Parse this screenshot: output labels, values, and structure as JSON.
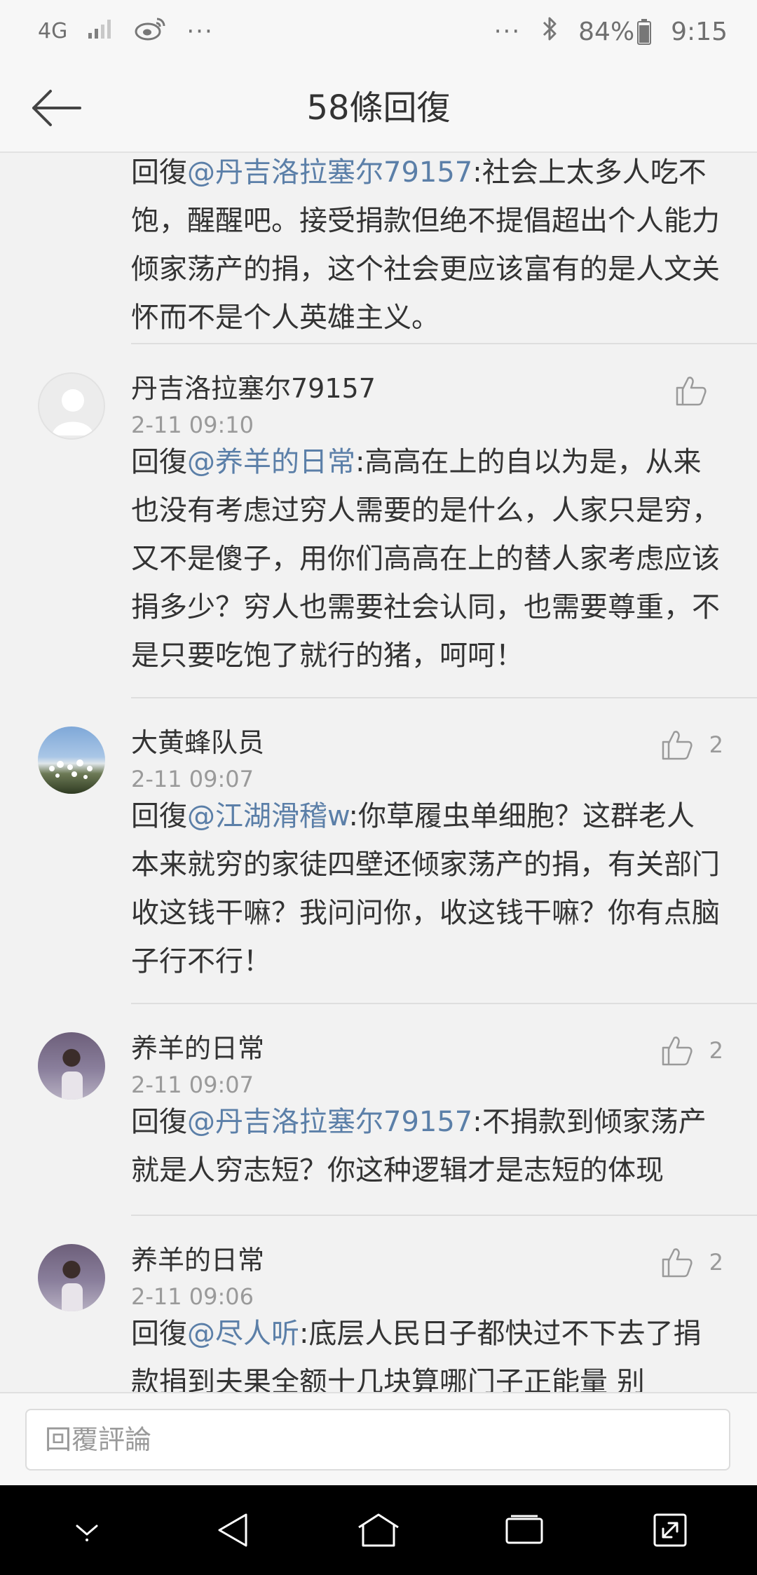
{
  "status_bar": {
    "network": "4G",
    "left_dots": "···",
    "right_dots": "···",
    "battery": "84%",
    "time": "9:15"
  },
  "header": {
    "title": "58條回復"
  },
  "truncated_comment": {
    "reply_prefix": "回復",
    "mention": "@丹吉洛拉塞尔79157",
    "text": ":社会上太多人吃不饱，醒醒吧。接受捐款但绝不提倡超出个人能力倾家荡产的捐，这个社会更应该富有的是人文关怀而不是个人英雄主义。"
  },
  "comments": [
    {
      "name": "丹吉洛拉塞尔79157",
      "time": "2-11 09:10",
      "likes": "",
      "reply_prefix": "回復",
      "mention": "@养羊的日常",
      "text": ":高高在上的自以为是，从来也没有考虑过穷人需要的是什么，人家只是穷，又不是傻子，用你们高高在上的替人家考虑应该捐多少？穷人也需要社会认同，也需要尊重，不是只要吃饱了就行的猪，呵呵！"
    },
    {
      "name": "大黄蜂队员",
      "time": "2-11 09:07",
      "likes": "2",
      "reply_prefix": "回復",
      "mention": "@江湖滑稽w",
      "text": ":你草履虫单细胞？这群老人本来就穷的家徒四壁还倾家荡产的捐，有关部门收这钱干嘛？我问问你，收这钱干嘛？你有点脑子行不行！"
    },
    {
      "name": "养羊的日常",
      "time": "2-11 09:07",
      "likes": "2",
      "reply_prefix": "回復",
      "mention": "@丹吉洛拉塞尔79157",
      "text": ":不捐款到倾家荡产就是人穷志短？你这种逻辑才是志短的体现"
    },
    {
      "name": "养羊的日常",
      "time": "2-11 09:06",
      "likes": "2",
      "reply_prefix": "回復",
      "mention": "@尽人听",
      "text": ":底层人民日子都快过不下去了捐款捐到夫果全额十几块算哪门子正能量 别"
    }
  ],
  "reply_bar": {
    "placeholder": "回覆評論"
  },
  "icons": {
    "back": "arrow-left-icon",
    "like": "thumbs-up-icon",
    "nav": [
      "chevron-down-icon",
      "back-triangle-icon",
      "home-icon",
      "recents-icon",
      "expand-icon"
    ]
  },
  "colors": {
    "mention": "#5b7fa8",
    "secondary_text": "#9a9a9a",
    "nav_bar": "#000000"
  }
}
